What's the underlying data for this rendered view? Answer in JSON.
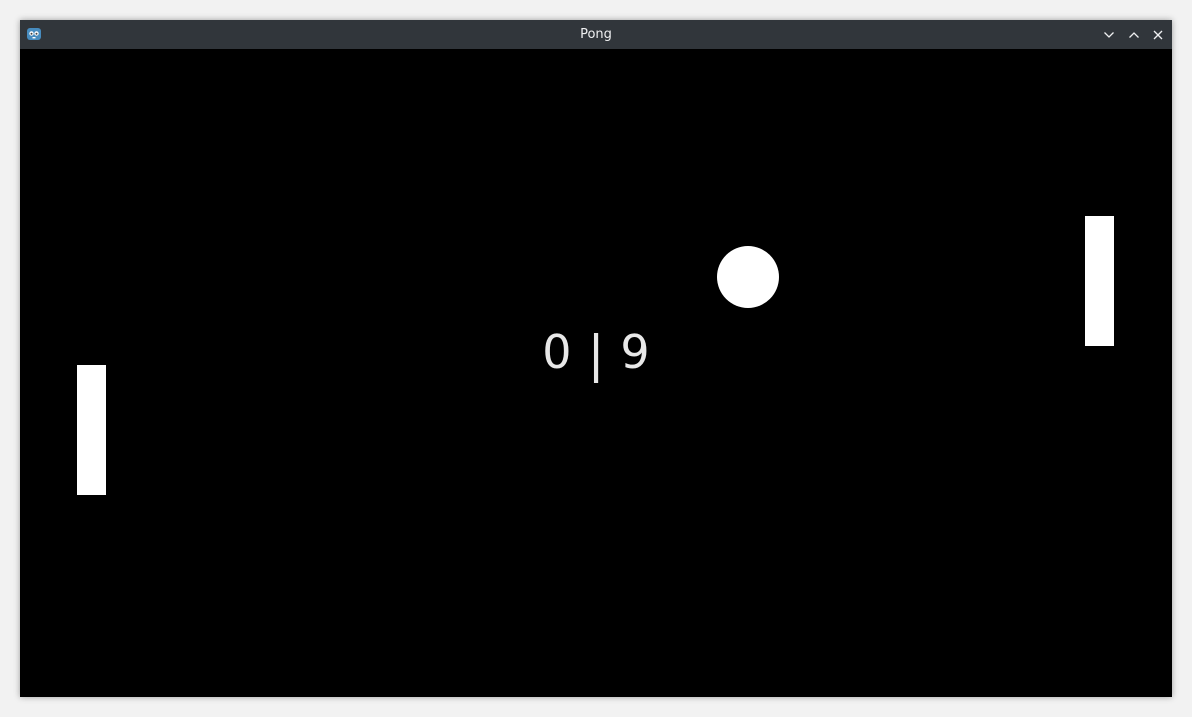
{
  "window": {
    "title": "Pong",
    "app_icon": "godot-icon",
    "controls": {
      "minimize_icon": "chevron-down-icon",
      "maximize_icon": "chevron-up-icon",
      "close_icon": "close-icon"
    }
  },
  "game": {
    "score": {
      "left": "0",
      "separator": "|",
      "right": "9"
    },
    "colors": {
      "background": "#000000",
      "objects": "#ffffff",
      "score_text": "#e8e8e8"
    }
  }
}
